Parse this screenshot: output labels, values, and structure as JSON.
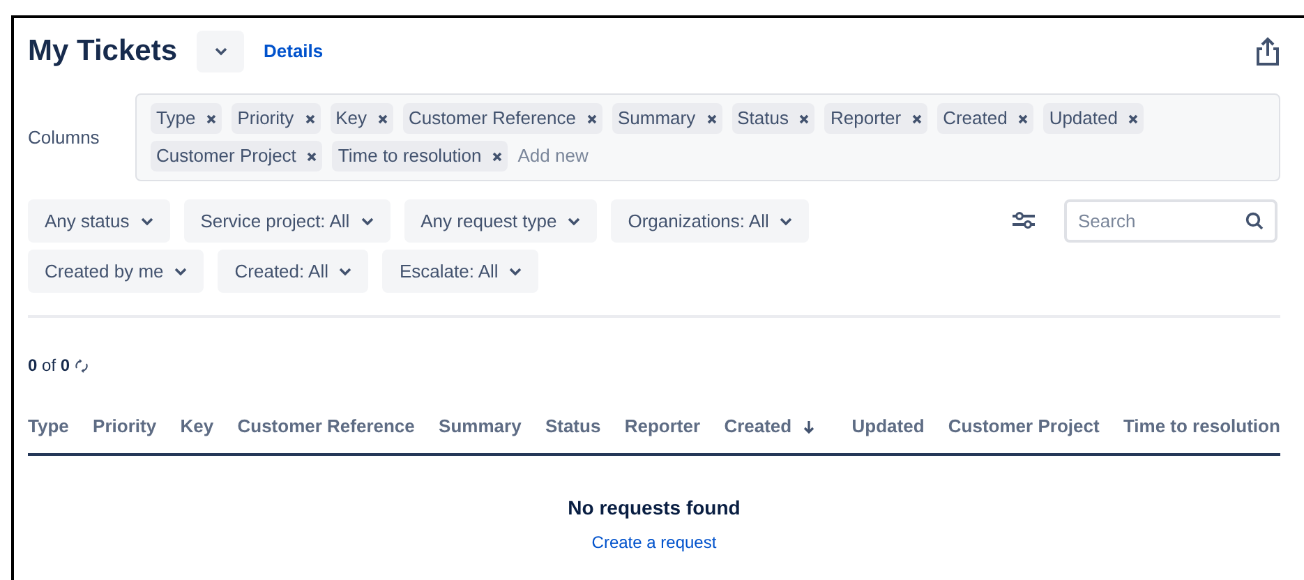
{
  "header": {
    "title": "My Tickets",
    "details_link": "Details"
  },
  "columns_field": {
    "label": "Columns",
    "tags": [
      "Type",
      "Priority",
      "Key",
      "Customer Reference",
      "Summary",
      "Status",
      "Reporter",
      "Created",
      "Updated",
      "Customer Project",
      "Time to resolution"
    ],
    "placeholder": "Add new"
  },
  "filters": [
    "Any status",
    "Service project: All",
    "Any request type",
    "Organizations: All",
    "Created by me",
    "Created: All",
    "Escalate: All"
  ],
  "search": {
    "placeholder": "Search"
  },
  "count": "**0** of **0**",
  "table": {
    "columns": [
      {
        "label": "Type",
        "sorted": false
      },
      {
        "label": "Priority",
        "sorted": false
      },
      {
        "label": "Key",
        "sorted": false
      },
      {
        "label": "Customer Reference",
        "sorted": false
      },
      {
        "label": "Summary",
        "sorted": false
      },
      {
        "label": "Status",
        "sorted": false
      },
      {
        "label": "Reporter",
        "sorted": false
      },
      {
        "label": "Created",
        "sorted": true
      },
      {
        "label": "Updated",
        "sorted": false
      },
      {
        "label": "Customer Project",
        "sorted": false
      },
      {
        "label": "Time to resolution",
        "sorted": false
      }
    ]
  },
  "empty_state": {
    "message": "No requests found",
    "link": "Create a request"
  }
}
